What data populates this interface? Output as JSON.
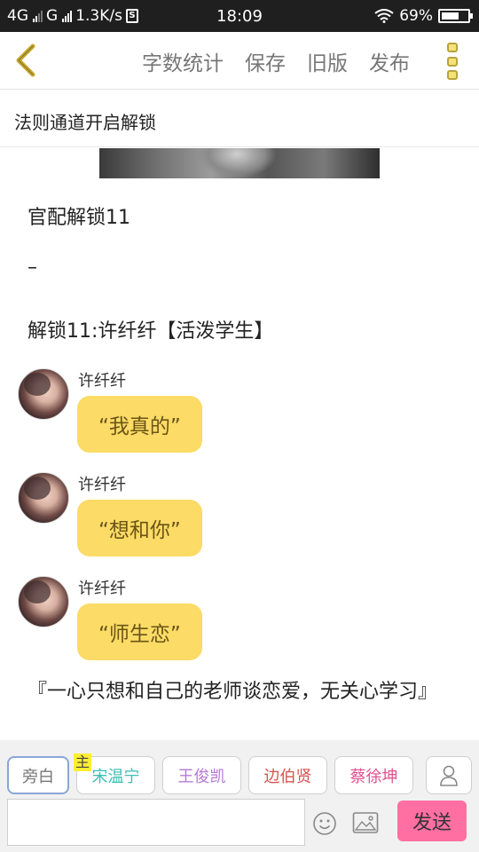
{
  "status_bar": {
    "network_label": "4G",
    "network2_label": "G",
    "speed": "1.3K/s",
    "sim_icon_letter": "S",
    "time": "18:09",
    "battery": "69%",
    "battery_level": 0.69
  },
  "toolbar": {
    "word_count_label": "字数统计",
    "save_label": "保存",
    "old_version_label": "旧版",
    "publish_label": "发布"
  },
  "chapter_title": "法则通道开启解锁",
  "content": {
    "para1": "官配解锁11",
    "para2": "–",
    "para3": "解锁11:许纤纤【活泼学生】",
    "messages": [
      {
        "name": "许纤纤",
        "text": "“我真的”"
      },
      {
        "name": "许纤纤",
        "text": "“想和你”"
      },
      {
        "name": "许纤纤",
        "text": "“师生恋”"
      }
    ],
    "para_last": "『一心只想和自己的老师谈恋爱，无关心学习』"
  },
  "characters": [
    {
      "label": "旁白",
      "color": "#777777",
      "badge": ""
    },
    {
      "label": "宋温宁",
      "color": "#3bbfb3",
      "badge": "主"
    },
    {
      "label": "王俊凯",
      "color": "#b57ad6",
      "badge": ""
    },
    {
      "label": "边伯贤",
      "color": "#d9534f",
      "badge": ""
    },
    {
      "label": "蔡徐坤",
      "color": "#e0508f",
      "badge": ""
    }
  ],
  "input": {
    "value": "",
    "placeholder": ""
  },
  "send_label": "发送",
  "colors": {
    "accent_yellow": "#fcdb66",
    "send_pink": "#ff6fa1",
    "back_arrow": "#c8a92e"
  }
}
